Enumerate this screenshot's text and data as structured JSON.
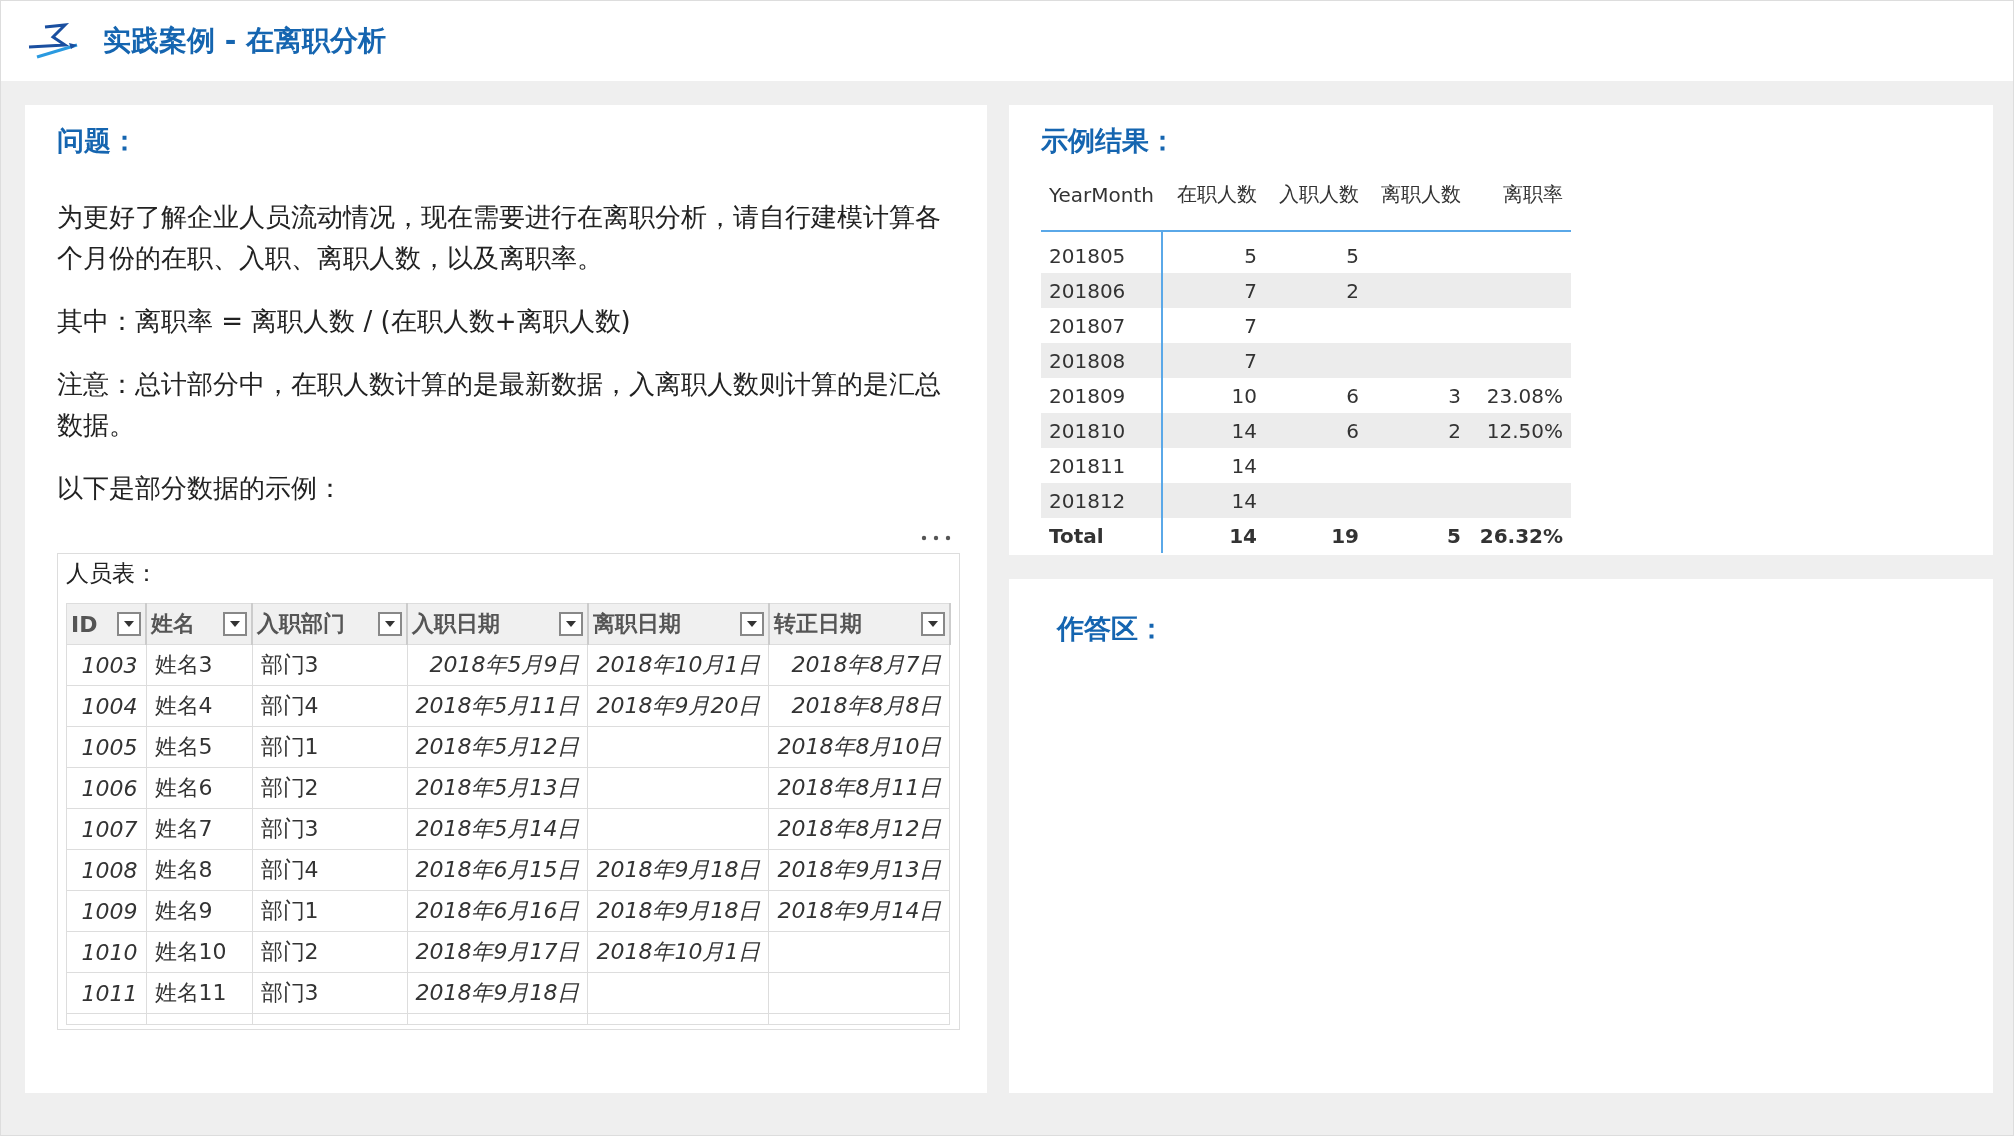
{
  "header": {
    "title": "实践案例 - 在离职分析"
  },
  "question": {
    "heading": "问题：",
    "paragraphs": [
      "为更好了解企业人员流动情况，现在需要进行在离职分析，请自行建模计算各个月份的在职、入职、离职人数，以及离职率。",
      "其中：离职率 = 离职人数 / (在职人数+离职人数)",
      "注意：总计部分中，在职人数计算的是最新数据，入离职人数则计算的是汇总数据。",
      "以下是部分数据的示例："
    ],
    "sheet": {
      "caption": "人员表：",
      "columns": [
        "ID",
        "姓名",
        "入职部门",
        "入职日期",
        "离职日期",
        "转正日期"
      ],
      "rows": [
        [
          "1003",
          "姓名3",
          "部门3",
          "2018年5月9日",
          "2018年10月1日",
          "2018年8月7日"
        ],
        [
          "1004",
          "姓名4",
          "部门4",
          "2018年5月11日",
          "2018年9月20日",
          "2018年8月8日"
        ],
        [
          "1005",
          "姓名5",
          "部门1",
          "2018年5月12日",
          null,
          "2018年8月10日"
        ],
        [
          "1006",
          "姓名6",
          "部门2",
          "2018年5月13日",
          null,
          "2018年8月11日"
        ],
        [
          "1007",
          "姓名7",
          "部门3",
          "2018年5月14日",
          null,
          "2018年8月12日"
        ],
        [
          "1008",
          "姓名8",
          "部门4",
          "2018年6月15日",
          "2018年9月18日",
          "2018年9月13日"
        ],
        [
          "1009",
          "姓名9",
          "部门1",
          "2018年6月16日",
          "2018年9月18日",
          "2018年9月14日"
        ],
        [
          "1010",
          "姓名10",
          "部门2",
          "2018年9月17日",
          "2018年10月1日",
          null
        ],
        [
          "1011",
          "姓名11",
          "部门3",
          "2018年9月18日",
          null,
          null
        ]
      ]
    }
  },
  "result": {
    "heading": "示例结果：",
    "columns": [
      "YearMonth",
      "在职人数",
      "入职人数",
      "离职人数",
      "离职率"
    ],
    "rows": [
      [
        "201805",
        "5",
        "5",
        null,
        null
      ],
      [
        "201806",
        "7",
        "2",
        null,
        null
      ],
      [
        "201807",
        "7",
        null,
        null,
        null
      ],
      [
        "201808",
        "7",
        null,
        null,
        null
      ],
      [
        "201809",
        "10",
        "6",
        "3",
        "23.08%"
      ],
      [
        "201810",
        "14",
        "6",
        "2",
        "12.50%"
      ],
      [
        "201811",
        "14",
        null,
        null,
        null
      ],
      [
        "201812",
        "14",
        null,
        null,
        null
      ]
    ],
    "total": [
      "Total",
      "14",
      "19",
      "5",
      "26.32%"
    ]
  },
  "answer": {
    "heading": "作答区："
  }
}
